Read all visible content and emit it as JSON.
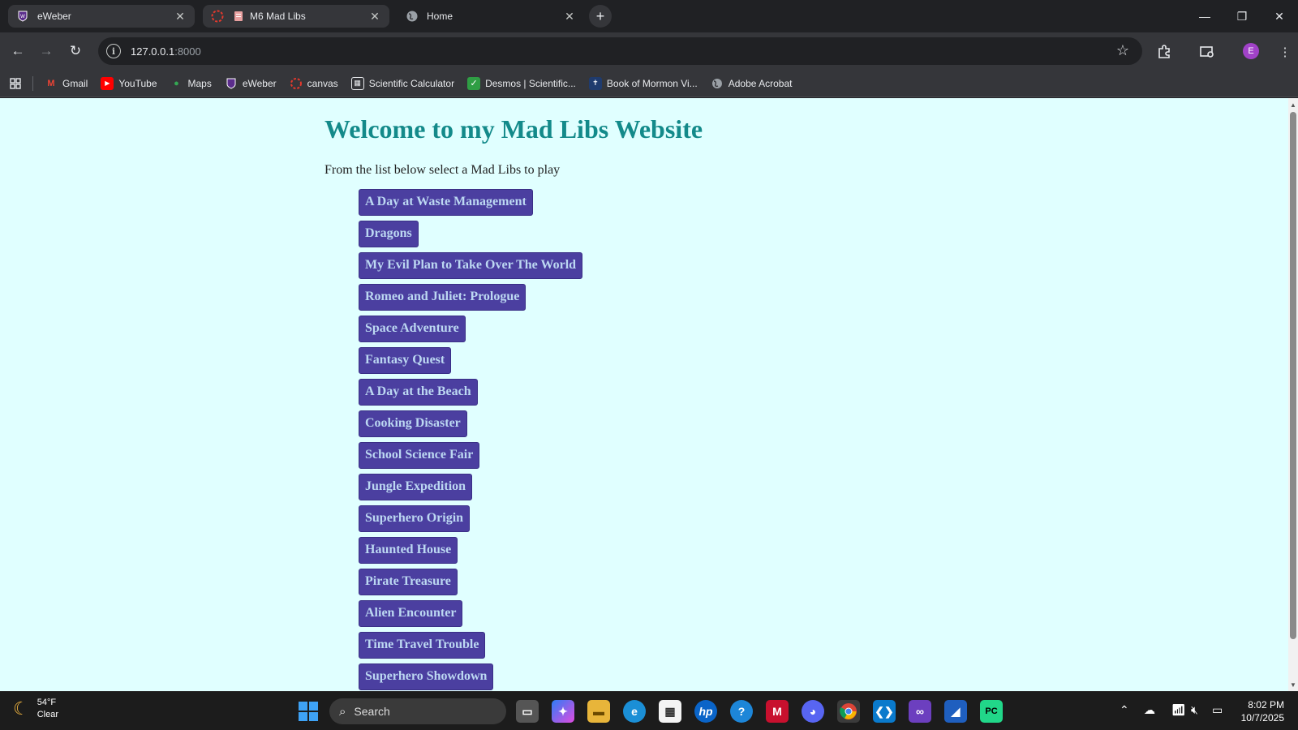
{
  "browser": {
    "tabs": [
      {
        "title": "eWeber",
        "close": "✕"
      },
      {
        "title": "M6 Mad Libs",
        "close": "✕"
      },
      {
        "title": "Home",
        "close": "✕"
      }
    ],
    "new_tab": "+",
    "address": {
      "host": "127.0.0.1",
      "port": ":8000"
    },
    "bookmarks": [
      {
        "label": "Gmail",
        "icon": "gmail-icon"
      },
      {
        "label": "YouTube",
        "icon": "youtube-icon"
      },
      {
        "label": "Maps",
        "icon": "maps-icon"
      },
      {
        "label": "eWeber",
        "icon": "eweber-icon"
      },
      {
        "label": "canvas",
        "icon": "canvas-icon"
      },
      {
        "label": "Scientific Calculator",
        "icon": "calculator-icon"
      },
      {
        "label": "Desmos | Scientific...",
        "icon": "desmos-icon"
      },
      {
        "label": "Book of Mormon Vi...",
        "icon": "book-icon"
      },
      {
        "label": "Adobe Acrobat",
        "icon": "globe-icon"
      }
    ],
    "profile_initial": "E"
  },
  "page": {
    "title": "Welcome to my Mad Libs Website",
    "intro": "From the list below select a Mad Libs to play",
    "games": [
      "A Day at Waste Management",
      "Dragons",
      "My Evil Plan to Take Over The World",
      "Romeo and Juliet: Prologue",
      "Space Adventure",
      "Fantasy Quest",
      "A Day at the Beach",
      "Cooking Disaster",
      "School Science Fair",
      "Jungle Expedition",
      "Superhero Origin",
      "Haunted House",
      "Pirate Treasure",
      "Alien Encounter",
      "Time Travel Trouble",
      "Superhero Showdown"
    ]
  },
  "taskbar": {
    "weather_temp": "54°F",
    "weather_cond": "Clear",
    "search_placeholder": "Search",
    "time": "8:02 PM",
    "date": "10/7/2025"
  },
  "colors": {
    "page_bg": "#e0ffff",
    "title": "#138a8a",
    "button_bg": "#4b3fa0",
    "button_text": "#bcd8f2"
  }
}
